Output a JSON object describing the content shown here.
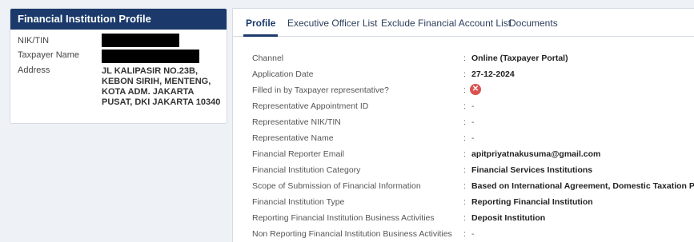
{
  "profile_card": {
    "title": "Financial Institution Profile",
    "fields": [
      {
        "label": "NIK/TIN",
        "value": ""
      },
      {
        "label": "Taxpayer Name",
        "value": ""
      },
      {
        "label": "Address",
        "value": "JL KALIPASIR NO.23B, KEBON SIRIH, MENTENG, KOTA ADM. JAKARTA PUSAT, DKI JAKARTA 10340"
      }
    ]
  },
  "tabs": [
    {
      "label": "Profile",
      "active": true
    },
    {
      "label": "Executive Officer List",
      "active": false
    },
    {
      "label": "Exclude Financial Account List",
      "active": false
    },
    {
      "label": "Documents",
      "active": false
    }
  ],
  "details": [
    {
      "label": "Channel",
      "colon": ":",
      "value": "Online (Taxpayer Portal)"
    },
    {
      "label": "Application Date",
      "colon": ":",
      "value": "27-12-2024"
    },
    {
      "label": "Filled in by Taxpayer representative?",
      "colon": ":",
      "icon": "x-circle-icon",
      "value": "✕"
    },
    {
      "label": "Representative Appointment ID",
      "colon": ":",
      "value": "-"
    },
    {
      "label": "Representative NIK/TIN",
      "colon": ":",
      "value": "-"
    },
    {
      "label": "Representative Name",
      "colon": ":",
      "value": "-"
    },
    {
      "label": "Financial Reporter Email",
      "colon": ":",
      "value": "apitpriyatnakusuma@gmail.com"
    },
    {
      "label": "Financial Institution Category",
      "colon": ":",
      "value": "Financial Services Institutions"
    },
    {
      "label": "Scope of Submission of Financial Information",
      "colon": ":",
      "value": "Based on International Agreement, Domestic Taxation Purposes"
    },
    {
      "label": "Financial Institution Type",
      "colon": ":",
      "value": "Reporting Financial Institution"
    },
    {
      "label": "Reporting Financial Institution Business Activities",
      "colon": ":",
      "value": "Deposit Institution"
    },
    {
      "label": "Non Reporting Financial Institution Business Activities",
      "colon": ":",
      "value": "-"
    }
  ],
  "colors": {
    "header_bg": "#1b3a6b",
    "x_icon": "#d9534f"
  }
}
